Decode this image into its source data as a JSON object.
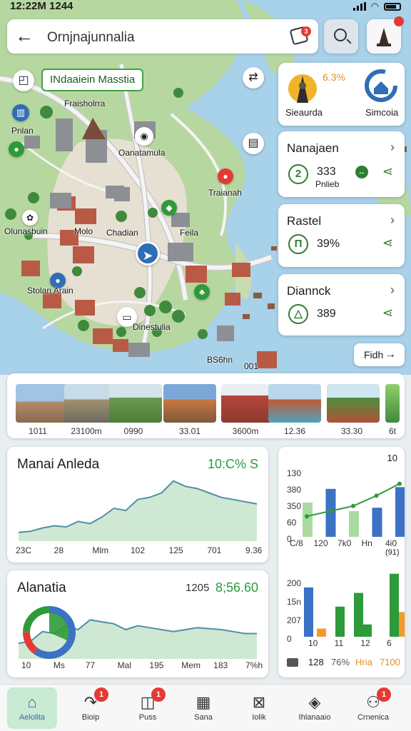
{
  "status": {
    "time": "12:22M 1244"
  },
  "search": {
    "query": "Ornjnajunnalia",
    "badge": "3"
  },
  "map": {
    "label_pill": "INdaaiein Masstia",
    "labels": [
      "Fraisholrra",
      "Pnlan",
      "Oanatamula",
      "Traianah",
      "Olunasbuin",
      "Molo",
      "Chadian",
      "Feila",
      "Stolan Arain",
      "Dinestulia",
      "BS6hn",
      "001"
    ]
  },
  "poi_card": {
    "percent": "6.3%",
    "left_label": "Sieaurda",
    "right_label": "Simcoia"
  },
  "list_cards": [
    {
      "title": "Nanajaen",
      "value": "333",
      "sub": "Pnlieb",
      "icon": "2"
    },
    {
      "title": "Rastel",
      "value": "39%",
      "icon": "Π"
    },
    {
      "title": "Diannck",
      "value": "389",
      "icon": "△"
    }
  ],
  "find_button": "Fidh",
  "photos": [
    "1011",
    "23100m",
    "0990",
    "33.01",
    "3600m",
    "12.36",
    "33.30",
    "6t"
  ],
  "panel1": {
    "title": "Manai Anleda",
    "value": "10:C% S",
    "x_ticks": [
      "23C",
      "28",
      "Mlm",
      "102",
      "125",
      "701",
      "9.36"
    ],
    "chart_data": {
      "type": "area",
      "x": [
        0,
        1,
        2,
        3,
        4,
        5,
        6,
        7,
        8,
        9,
        10,
        11,
        12,
        13,
        14,
        15,
        16,
        17,
        18,
        19,
        20
      ],
      "values": [
        8,
        9,
        12,
        14,
        13,
        18,
        16,
        22,
        30,
        28,
        38,
        40,
        44,
        55,
        50,
        48,
        44,
        40,
        38,
        36,
        34
      ],
      "ylim": [
        0,
        60
      ]
    }
  },
  "panel2": {
    "title": "Alanatia",
    "value_left": "1205",
    "value": "8;56.60",
    "x_ticks": [
      "10",
      "Ms",
      "77",
      "Mal",
      "195",
      "Mem",
      "183",
      "7%h"
    ],
    "donut": {
      "blue": 0.6,
      "red": 0.15,
      "green": 0.25
    },
    "chart_data": {
      "type": "area",
      "x": [
        0,
        1,
        2,
        3,
        4,
        5,
        6,
        7,
        8,
        9,
        10,
        11,
        12,
        13,
        14,
        15,
        16,
        17,
        18,
        19,
        20
      ],
      "values": [
        16,
        18,
        28,
        26,
        34,
        30,
        40,
        38,
        36,
        30,
        34,
        32,
        30,
        28,
        30,
        32,
        31,
        30,
        28,
        26,
        26
      ],
      "ylim": [
        0,
        60
      ]
    }
  },
  "panel3": {
    "top": {
      "value_label": "10",
      "y_ticks": [
        "130",
        "380",
        "350",
        "60",
        "0"
      ],
      "x_ticks": [
        "C/8",
        "120",
        "7k0",
        "Hn",
        "4i0"
      ],
      "sub": "(91)",
      "chart_data": {
        "type": "bar",
        "categories": [
          "C/8",
          "120",
          "7k0",
          "Hn",
          "4i0"
        ],
        "series": [
          {
            "name": "light",
            "values": [
              200,
              0,
              150,
              0,
              0
            ]
          },
          {
            "name": "blue",
            "values": [
              0,
              280,
              0,
              170,
              290
            ]
          }
        ],
        "line": [
          120,
          150,
          180,
          240,
          310
        ],
        "ylim": [
          0,
          400
        ]
      }
    },
    "bottom": {
      "y_ticks": [
        "200",
        "15n",
        "207",
        "0"
      ],
      "x_ticks": [
        "10",
        "11",
        "12",
        "6"
      ],
      "legend": [
        "128",
        "76%",
        "Hria",
        "7100"
      ],
      "chart_data": {
        "type": "bar",
        "categories": [
          "10",
          "11",
          "12",
          "6"
        ],
        "series": [
          {
            "name": "blue",
            "values": [
              180,
              0,
              0,
              0
            ]
          },
          {
            "name": "orange",
            "values": [
              30,
              0,
              0,
              90
            ]
          },
          {
            "name": "green",
            "values": [
              0,
              110,
              45,
              230
            ]
          },
          {
            "name": "green2",
            "values": [
              0,
              0,
              160,
              0
            ]
          }
        ],
        "ylim": [
          0,
          250
        ]
      }
    }
  },
  "nav": [
    {
      "label": "Aelolita",
      "glyph": "⌂",
      "badge": ""
    },
    {
      "label": "Bioip",
      "glyph": "↷",
      "badge": "1"
    },
    {
      "label": "Puss",
      "glyph": "◫",
      "badge": "1"
    },
    {
      "label": "Sana",
      "glyph": "▦",
      "badge": ""
    },
    {
      "label": "Iolik",
      "glyph": "⊠",
      "badge": ""
    },
    {
      "label": "Ihlanaaio",
      "glyph": "◈",
      "badge": ""
    },
    {
      "label": "Crnenica",
      "glyph": "⚇",
      "badge": "1"
    }
  ],
  "colors": {
    "accent": "#2e9a3a",
    "blue": "#3b72c4",
    "orange": "#f39a2a",
    "badge": "#e53935"
  }
}
